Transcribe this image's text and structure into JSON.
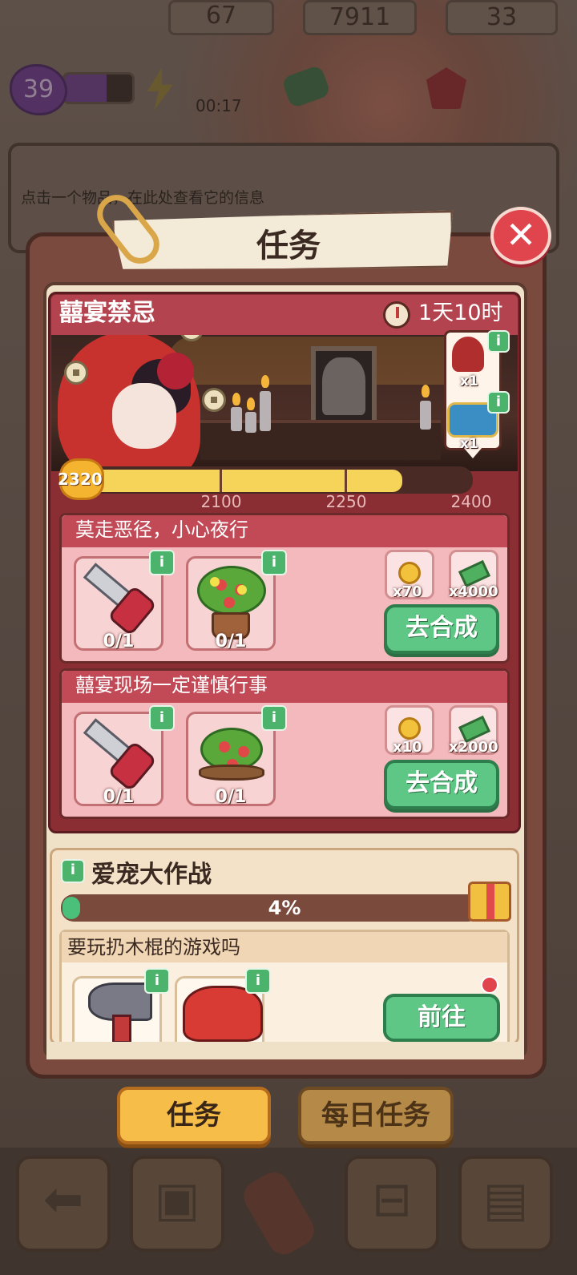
{
  "hud": {
    "level": "39",
    "energy": "67",
    "energy_timer": "00:17",
    "cash": "7911",
    "gems": "33"
  },
  "info_panel": {
    "text": "点击一个物品，在此处查看它的信息"
  },
  "dialog": {
    "title": "任务",
    "close_glyph": "✕"
  },
  "event": {
    "name": "囍宴禁忌",
    "time_left": "1天10时",
    "rewards": [
      {
        "icon": "bride-figure-icon",
        "qty": "x1"
      },
      {
        "icon": "treasure-chest-icon",
        "qty": "x1"
      }
    ],
    "progress": {
      "current": "2320",
      "milestones": [
        "2100",
        "2250",
        "2400"
      ],
      "fill_fraction": 0.78
    },
    "info_glyph": "i"
  },
  "tasks": [
    {
      "title": "莫走恶径，小心夜行",
      "items": [
        {
          "icon": "hacksaw-icon",
          "count": "0/1"
        },
        {
          "icon": "flower-bonsai-icon",
          "count": "0/1"
        }
      ],
      "rewards": [
        {
          "icon": "gold-coin-icon",
          "qty": "x70"
        },
        {
          "icon": "cash-stack-icon",
          "qty": "x4000"
        }
      ],
      "button": "去合成"
    },
    {
      "title": "囍宴现场一定谨慎行事",
      "items": [
        {
          "icon": "hacksaw-icon",
          "count": "0/1"
        },
        {
          "icon": "berry-bush-icon",
          "count": "0/1"
        }
      ],
      "rewards": [
        {
          "icon": "gold-coin-icon",
          "qty": "x10"
        },
        {
          "icon": "cash-stack-icon",
          "qty": "x2000"
        }
      ],
      "button": "去合成"
    }
  ],
  "side_quest": {
    "name": "爱宠大作战",
    "progress_label": "4%",
    "progress_fraction": 0.04,
    "subtask": {
      "title": "要玩扔木棍的游戏吗",
      "items": [
        {
          "icon": "axe-icon"
        },
        {
          "icon": "glove-icon"
        }
      ],
      "button": "前往"
    }
  },
  "tabs": [
    {
      "label": "任务",
      "active": true
    },
    {
      "label": "每日任务",
      "active": false
    }
  ],
  "bottom_nav": [
    {
      "icon": "back-arrow-icon"
    },
    {
      "icon": "backpack-icon"
    },
    {
      "icon": "shovel-icon"
    },
    {
      "icon": "shop-basket-icon"
    },
    {
      "icon": "clipboard-icon"
    }
  ],
  "colors": {
    "accent_red": "#b3434e",
    "button_green": "#5fc786",
    "tab_active": "#f7bd49",
    "progress_yellow": "#f6d45a"
  }
}
